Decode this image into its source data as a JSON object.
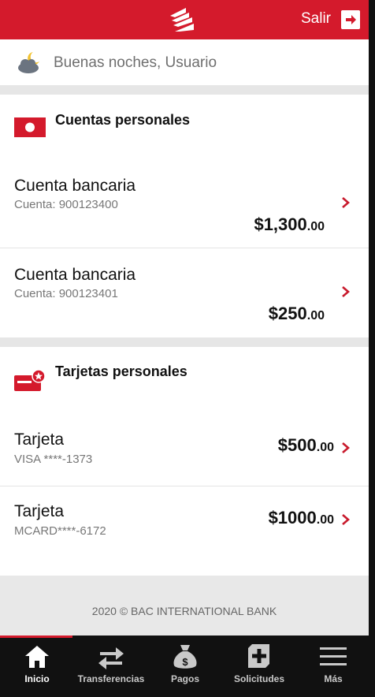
{
  "header": {
    "logout_label": "Salir"
  },
  "greeting": {
    "text": "Buenas noches, Usuario"
  },
  "accounts": {
    "title": "Cuentas personales",
    "items": [
      {
        "title": "Cuenta bancaria",
        "subtitle": "Cuenta: 900123400",
        "amount": "$1,300",
        "cents": ".00"
      },
      {
        "title": "Cuenta bancaria",
        "subtitle": "Cuenta: 900123401",
        "amount": "$250",
        "cents": ".00"
      }
    ]
  },
  "cards": {
    "title": "Tarjetas personales",
    "items": [
      {
        "title": "Tarjeta",
        "subtitle": "VISA ****-1373",
        "amount": "$500",
        "cents": ".00"
      },
      {
        "title": "Tarjeta",
        "subtitle": "MCARD****-6172",
        "amount": "$1000",
        "cents": ".00"
      }
    ]
  },
  "footer": {
    "copyright": "2020 © BAC INTERNATIONAL BANK"
  },
  "nav": {
    "items": [
      {
        "label": "Inicio",
        "icon": "home-icon",
        "active": true
      },
      {
        "label": "Transferencias",
        "icon": "transfer-arrows-icon"
      },
      {
        "label": "Pagos",
        "icon": "money-bag-icon"
      },
      {
        "label": "Solicitudes",
        "icon": "add-request-icon"
      },
      {
        "label": "Más",
        "icon": "menu-icon"
      }
    ]
  },
  "colors": {
    "brand_red": "#d41a2c",
    "nav_background": "#111111",
    "text_dark": "#111111",
    "text_muted": "#777777"
  }
}
